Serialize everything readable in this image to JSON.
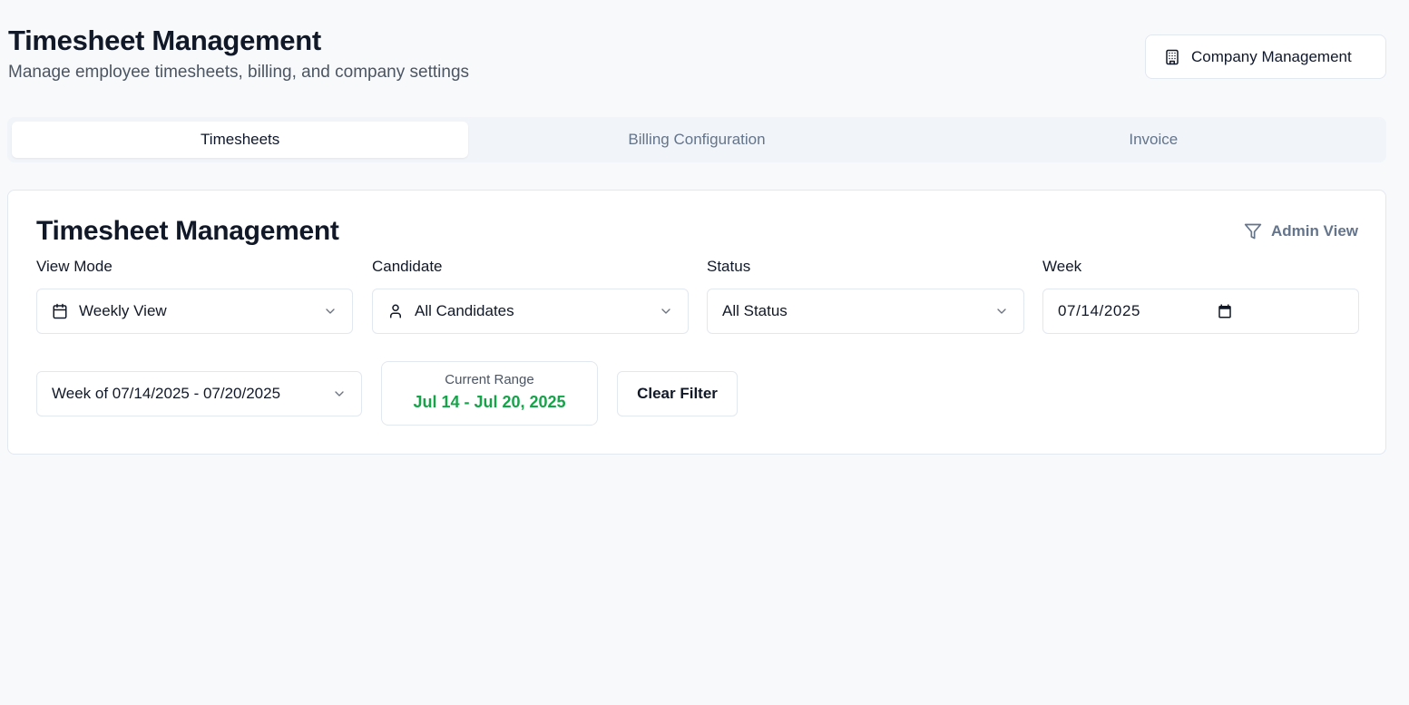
{
  "header": {
    "title": "Timesheet Management",
    "subtitle": "Manage employee timesheets, billing, and company settings",
    "company_button": "Company Management",
    "company_icon": "building-icon"
  },
  "tabs": [
    {
      "label": "Timesheets",
      "active": true
    },
    {
      "label": "Billing Configuration",
      "active": false
    },
    {
      "label": "Invoice",
      "active": false
    }
  ],
  "card": {
    "title": "Timesheet Management",
    "admin_view": "Admin View",
    "admin_icon": "filter-icon",
    "filters": {
      "view_mode": {
        "label": "View Mode",
        "value": "Weekly View",
        "icon": "calendar-icon"
      },
      "candidate": {
        "label": "Candidate",
        "value": "All Candidates",
        "icon": "user-icon"
      },
      "status": {
        "label": "Status",
        "value": "All Status"
      },
      "week": {
        "label": "Week",
        "value": "07/14/2025",
        "icon": "calendar-icon"
      }
    },
    "week_select": "Week of 07/14/2025 - 07/20/2025",
    "current_range": {
      "label": "Current Range",
      "value": "Jul 14 - Jul 20, 2025",
      "color": "#16a34a"
    },
    "clear_filter": "Clear Filter"
  }
}
